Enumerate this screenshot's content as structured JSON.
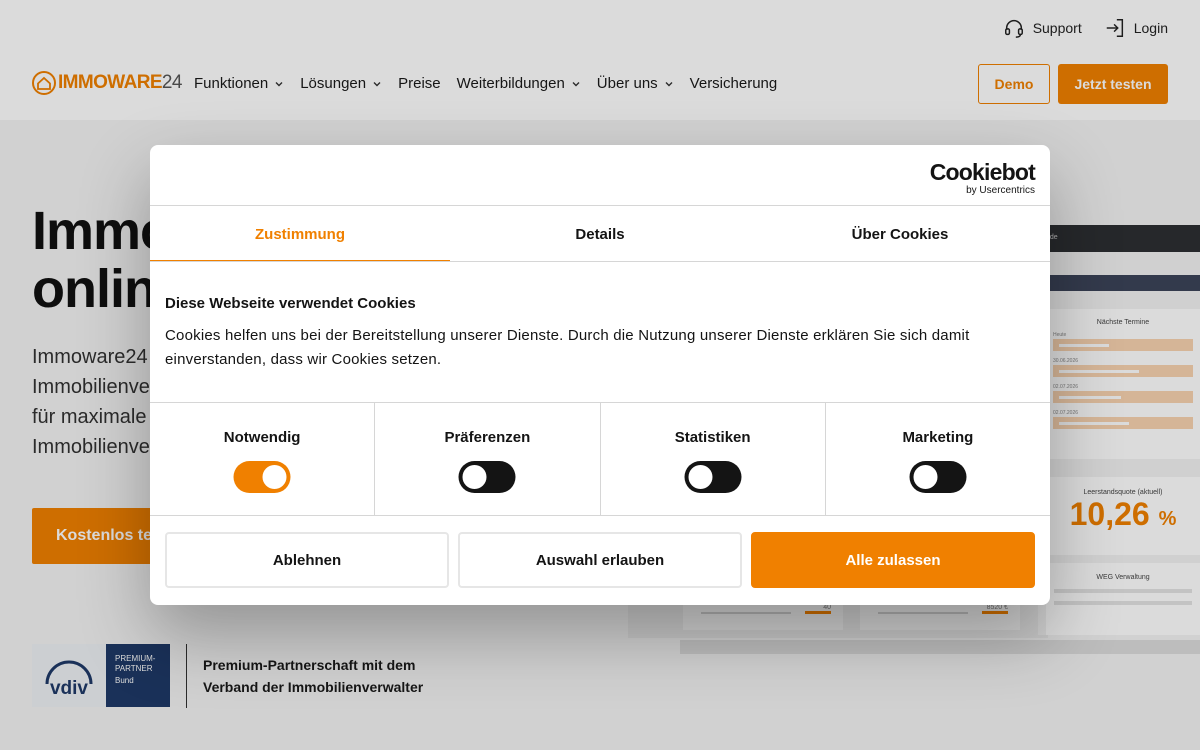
{
  "header": {
    "logo": {
      "brand": "IMMOWARE",
      "num": "24"
    },
    "utility": [
      {
        "label": "Support",
        "icon": "headset-icon"
      },
      {
        "label": "Login",
        "icon": "login-icon"
      }
    ],
    "nav": [
      {
        "label": "Funktionen",
        "dropdown": true
      },
      {
        "label": "Lösungen",
        "dropdown": true
      },
      {
        "label": "Preise",
        "dropdown": false
      },
      {
        "label": "Weiterbildungen",
        "dropdown": true
      },
      {
        "label": "Über uns",
        "dropdown": true
      },
      {
        "label": "Versicherung",
        "dropdown": false
      }
    ],
    "demo_label": "Demo",
    "test_label": "Jetzt testen"
  },
  "hero": {
    "title_line1": "Immo",
    "title_line2": "onlin",
    "text_lines": [
      "Immoware24",
      "Immobilienve",
      "für maximale",
      "Immobilienve"
    ],
    "cta_label": "Kostenlos tes"
  },
  "partner": {
    "vdiv": "vdiv",
    "premium_line1": "PREMIUM-",
    "premium_line2": "PARTNER",
    "premium_sub": "Bund",
    "text_line1": "Premium-Partnerschaft mit dem",
    "text_line2": "Verband der Immobilienverwalter"
  },
  "mockup": {
    "url_fragment": "4.de",
    "next_title": "Nächste Termine",
    "next_dates": [
      "Heute",
      "30.06.2026",
      "02.07.2026",
      "02.07.2026"
    ],
    "kpi_title": "Leerstandsquote (aktuell)",
    "kpi_value": "10,26",
    "kpi_unit": "%",
    "weg_title": "WEG Verwaltung",
    "back_values": [
      "40",
      "8520 €"
    ]
  },
  "dialog": {
    "brand": "Cookiebot",
    "brand_sub": "by Usercentrics",
    "tabs": [
      {
        "label": "Zustimmung",
        "active": true
      },
      {
        "label": "Details",
        "active": false
      },
      {
        "label": "Über Cookies",
        "active": false
      }
    ],
    "title": "Diese Webseite verwendet Cookies",
    "body": "Cookies helfen uns bei der Bereitstellung unserer Dienste. Durch die Nutzung unserer Dienste erklären Sie sich damit einverstanden, dass wir Cookies setzen.",
    "categories": [
      {
        "label": "Notwendig",
        "on": true
      },
      {
        "label": "Präferenzen",
        "on": false
      },
      {
        "label": "Statistiken",
        "on": false
      },
      {
        "label": "Marketing",
        "on": false
      }
    ],
    "buttons": {
      "reject": "Ablehnen",
      "allow_selection": "Auswahl erlauben",
      "allow_all": "Alle zulassen"
    }
  },
  "colors": {
    "accent": "#f08000",
    "navy": "#1f3a68",
    "dark": "#141414"
  }
}
